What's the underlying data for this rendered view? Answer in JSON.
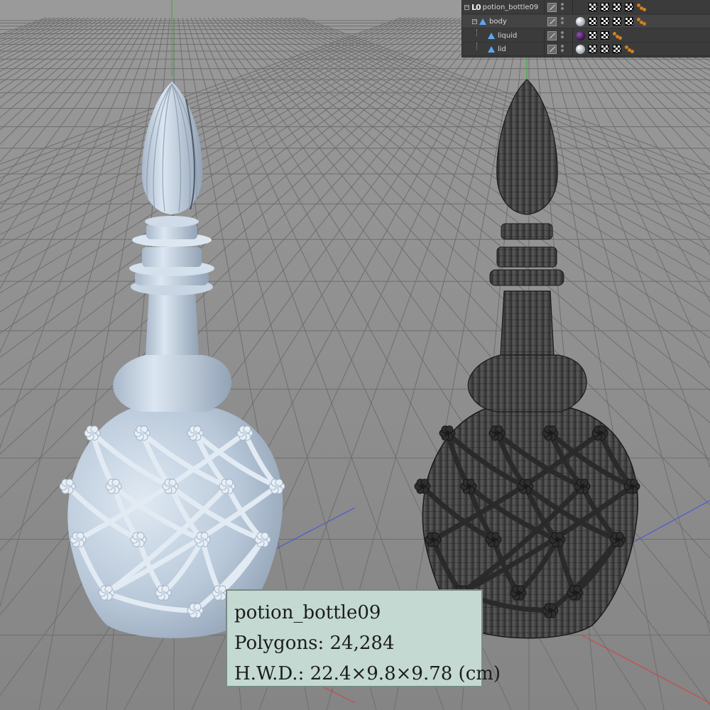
{
  "object_manager": {
    "objects": [
      {
        "name": "potion_bottle09",
        "icon": "null-object-icon",
        "material": null,
        "tags": [
          "checker-tag",
          "checker-tag",
          "checker-tag",
          "checker-tag",
          "phong-tag"
        ]
      },
      {
        "name": "body",
        "icon": "polygon-object-icon",
        "material": "white",
        "tags": [
          "checker-tag",
          "checker-tag",
          "checker-tag",
          "checker-tag",
          "phong-tag"
        ]
      },
      {
        "name": "liquid",
        "icon": "polygon-object-icon",
        "material": "purple",
        "tags": [
          "checker-tag",
          "checker-tag",
          "phong-tag"
        ]
      },
      {
        "name": "lid",
        "icon": "polygon-object-icon",
        "material": "white",
        "tags": [
          "checker-tag",
          "checker-tag",
          "checker-tag",
          "phong-tag"
        ]
      }
    ]
  },
  "info_label": {
    "name": "potion_bottle09",
    "polygons": "Polygons: 24,284",
    "dimensions": "H.W.D.: 22.4×9.8×9.78 (cm)"
  },
  "colors": {
    "viewport_bg": "#8a8a8a",
    "grid_line": "#6e6e6e",
    "shaded_model": "#b9cadb",
    "wire_model": "#4a4a4a",
    "wire_line": "#1e1e1e",
    "axis_y": "#3ab03a",
    "axis_z": "#4a5ad0",
    "axis_x": "#c84a4a",
    "label_bg": "#c3d9d2"
  }
}
